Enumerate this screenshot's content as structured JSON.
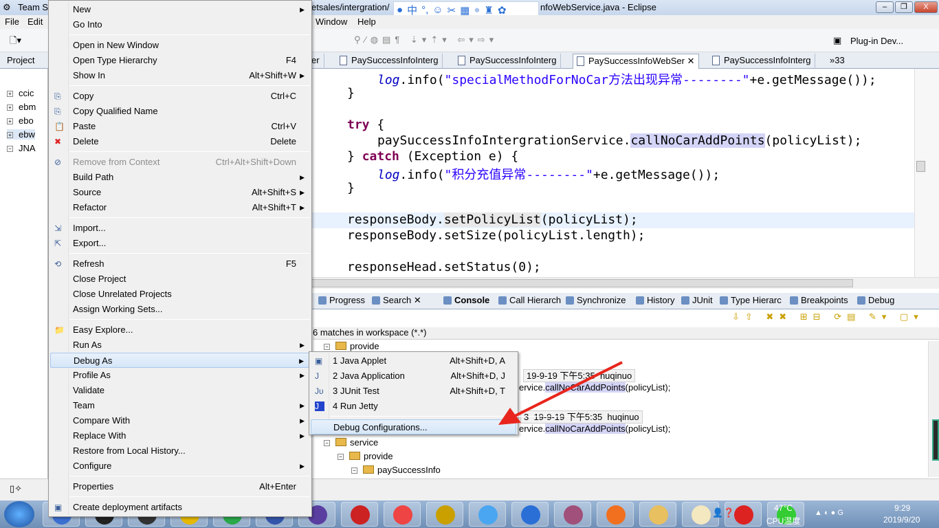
{
  "window": {
    "title_left": "Team S",
    "title_mid": "etsales/intergration/",
    "title_right": "nfoWebService.java - Eclipse",
    "buttons": [
      "minimize",
      "restore",
      "close"
    ]
  },
  "ime_toolbar": {
    "icons": [
      "user-icon",
      "chinese-mode-icon",
      "punctuation-icon",
      "emoji-icon",
      "scissors-icon",
      "keyboard-icon",
      "person-icon",
      "shirt-icon",
      "gear-icon"
    ],
    "mode": "中"
  },
  "menubar": [
    "File",
    "Edit",
    "Window",
    "Help"
  ],
  "toolbar": {
    "perspective": "Plug-in Dev..."
  },
  "left_pane": {
    "title": "Project",
    "items": [
      "ccic",
      "ebm",
      "ebo",
      "ebw",
      "JNA"
    ]
  },
  "editor_tabs": [
    {
      "label": "er"
    },
    {
      "label": "PaySuccessInfoInterg"
    },
    {
      "label": "PaySuccessInfoInterg"
    },
    {
      "label": "PaySuccessInfoWebSer",
      "active": true
    },
    {
      "label": "PaySuccessInfoInterg"
    },
    {
      "label": "»33"
    }
  ],
  "code": {
    "lines": [
      {
        "indent": "    ",
        "parts": [
          [
            "it",
            "log"
          ],
          [
            "",
            "."
          ],
          [
            "",
            "info("
          ],
          [
            "st",
            "\"specialMethodForNoCar方法出现异常--------\""
          ],
          [
            "",
            "+e.getMessage());"
          ]
        ]
      },
      {
        "indent": "",
        "parts": [
          [
            "",
            "}"
          ]
        ]
      },
      {
        "indent": "",
        "parts": []
      },
      {
        "indent": "",
        "parts": [
          [
            "kw",
            "try"
          ],
          [
            "",
            " {"
          ]
        ]
      },
      {
        "indent": "    ",
        "parts": [
          [
            "",
            "paySuccessInfoIntergrationService."
          ],
          [
            "hl",
            "callNoCarAddPoints"
          ],
          [
            "",
            "(policyList);"
          ]
        ]
      },
      {
        "indent": "",
        "parts": [
          [
            "",
            "} "
          ],
          [
            "kw",
            "catch"
          ],
          [
            "",
            " (Exception e) {"
          ]
        ]
      },
      {
        "indent": "    ",
        "parts": [
          [
            "it",
            "log"
          ],
          [
            "",
            ".info("
          ],
          [
            "st",
            "\"积分充值异常--------\""
          ],
          [
            "",
            "+e.getMessage());"
          ]
        ]
      },
      {
        "indent": "",
        "parts": [
          [
            "",
            "}"
          ]
        ]
      },
      {
        "indent": "",
        "parts": []
      },
      {
        "indent": "",
        "parts": [
          [
            "",
            "responseBody."
          ],
          [
            "hl2",
            "setPolicyList"
          ],
          [
            "",
            "(policyList);"
          ]
        ],
        "current": true
      },
      {
        "indent": "",
        "parts": [
          [
            "",
            "responseBody.setSize(policyList.length);"
          ]
        ]
      },
      {
        "indent": "",
        "parts": []
      },
      {
        "indent": "",
        "parts": [
          [
            "",
            "responseHead.setStatus(0);"
          ]
        ]
      }
    ]
  },
  "panel_tabs": [
    "Progress",
    "Search",
    "Console",
    "Call Hierarch",
    "Synchronize",
    "History",
    "JUnit",
    "Type Hierarc",
    "Breakpoints",
    "Debug"
  ],
  "search": {
    "summary": "6 matches in workspace (*.*)",
    "rows": [
      {
        "type": "folder",
        "label": "provide",
        "level": 0
      },
      {
        "type": "chip",
        "label": "19-9-19 下午5:35  huqinuo"
      },
      {
        "type": "match",
        "pre": "ervice.",
        "hit": "callNoCarAddPoints",
        "post": "(policyList);"
      },
      {
        "type": "chip",
        "label": "3  19-9-19 下午5:35  huqinuo"
      },
      {
        "type": "match",
        "pre": "ervice.",
        "hit": "callNoCarAddPoints",
        "post": "(policyList);"
      },
      {
        "type": "folder",
        "label": "service",
        "level": 0
      },
      {
        "type": "folder",
        "label": "provide",
        "level": 1
      },
      {
        "type": "folder",
        "label": "paySuccessInfo",
        "level": 2
      }
    ]
  },
  "context_menu": [
    {
      "label": "New",
      "arrow": true
    },
    {
      "label": "Go Into"
    },
    {
      "sep": true
    },
    {
      "label": "Open in New Window"
    },
    {
      "label": "Open Type Hierarchy",
      "shortcut": "F4"
    },
    {
      "label": "Show In",
      "shortcut": "Alt+Shift+W",
      "arrow": true
    },
    {
      "sep": true
    },
    {
      "label": "Copy",
      "shortcut": "Ctrl+C",
      "icon": "copy-icon"
    },
    {
      "label": "Copy Qualified Name",
      "icon": "copy-icon"
    },
    {
      "label": "Paste",
      "shortcut": "Ctrl+V",
      "icon": "paste-icon"
    },
    {
      "label": "Delete",
      "shortcut": "Delete",
      "icon": "delete-icon"
    },
    {
      "sep": true
    },
    {
      "label": "Remove from Context",
      "shortcut": "Ctrl+Alt+Shift+Down",
      "disabled": true,
      "icon": "remove-icon"
    },
    {
      "label": "Build Path",
      "arrow": true
    },
    {
      "label": "Source",
      "shortcut": "Alt+Shift+S",
      "arrow": true
    },
    {
      "label": "Refactor",
      "shortcut": "Alt+Shift+T",
      "arrow": true
    },
    {
      "sep": true
    },
    {
      "label": "Import...",
      "icon": "import-icon"
    },
    {
      "label": "Export...",
      "icon": "export-icon"
    },
    {
      "sep": true
    },
    {
      "label": "Refresh",
      "shortcut": "F5",
      "icon": "refresh-icon"
    },
    {
      "label": "Close Project"
    },
    {
      "label": "Close Unrelated Projects"
    },
    {
      "label": "Assign Working Sets..."
    },
    {
      "sep": true
    },
    {
      "label": "Easy Explore...",
      "icon": "folder-icon"
    },
    {
      "label": "Run As",
      "arrow": true
    },
    {
      "label": "Debug As",
      "arrow": true,
      "selected": true
    },
    {
      "label": "Profile As",
      "arrow": true
    },
    {
      "label": "Validate"
    },
    {
      "label": "Team",
      "arrow": true
    },
    {
      "label": "Compare With",
      "arrow": true
    },
    {
      "label": "Replace With",
      "arrow": true
    },
    {
      "label": "Restore from Local History..."
    },
    {
      "label": "Configure",
      "arrow": true
    },
    {
      "sep": true
    },
    {
      "label": "Properties",
      "shortcut": "Alt+Enter"
    },
    {
      "sep": true
    },
    {
      "label": "Create deployment artifacts",
      "icon": "deploy-icon"
    }
  ],
  "submenu": [
    {
      "label": "1 Java Applet",
      "shortcut": "Alt+Shift+D, A",
      "icon": "java-applet-icon"
    },
    {
      "label": "2 Java Application",
      "shortcut": "Alt+Shift+D, J",
      "icon": "java-application-icon"
    },
    {
      "label": "3 JUnit Test",
      "shortcut": "Alt+Shift+D, T",
      "icon": "junit-icon"
    },
    {
      "label": "4 Run Jetty",
      "icon": "jetty-icon"
    },
    {
      "sep": true
    },
    {
      "label": "Debug Configurations...",
      "selected": true
    }
  ],
  "annotation": {
    "arrow_color": "#e8261d"
  },
  "taskbar": {
    "temp": "47℃",
    "temp_label": "CPU温度",
    "time": "9:29",
    "date": "2019/9/20",
    "apps": [
      "chrome",
      "terminal",
      "terminal2",
      "axure",
      "chrome2",
      "eclipse",
      "game",
      "filezilla",
      "hedgehog",
      "ultraedit",
      "qq",
      "wps",
      "database",
      "firefox",
      "explorer",
      "java",
      "gitee",
      "wechat"
    ]
  }
}
